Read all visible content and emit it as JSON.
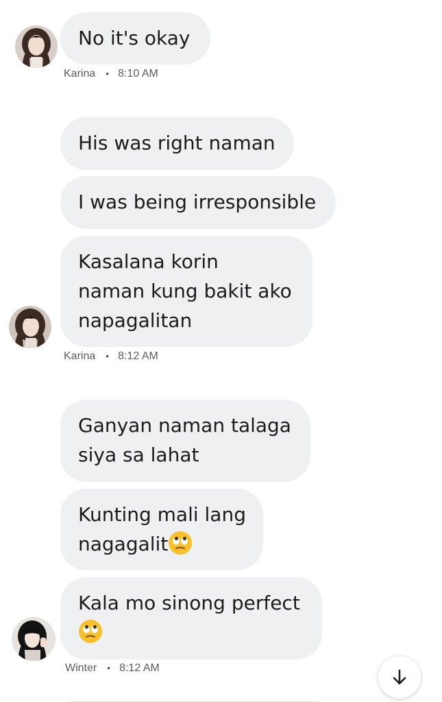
{
  "messages": {
    "g1": {
      "bubbles": [
        "No it's okay"
      ],
      "sender": "Karina",
      "time": "8:10 AM"
    },
    "g2": {
      "bubbles": [
        "His was right naman",
        "I was being irresponsible",
        [
          "Kasalana korin",
          "naman kung bakit ako",
          "napagalitan"
        ]
      ],
      "sender": "Karina",
      "time": "8:12 AM"
    },
    "g3": {
      "bubbles": [
        [
          "Ganyan naman talaga",
          "siya sa lahat"
        ],
        [
          "Kunting mali lang",
          "nagagalit"
        ],
        [
          "Kala mo sinong perfect"
        ]
      ],
      "sender": "Winter",
      "time": "8:12 AM"
    }
  },
  "separator": "•",
  "icons": {
    "emoji": "face-with-rolling-eyes-icon",
    "scroll": "arrow-down-icon"
  },
  "colors": {
    "bubble": "#eef0f1",
    "text": "#1b1b1b",
    "meta": "#5b5b5b",
    "emoji": "#f7c02b"
  }
}
